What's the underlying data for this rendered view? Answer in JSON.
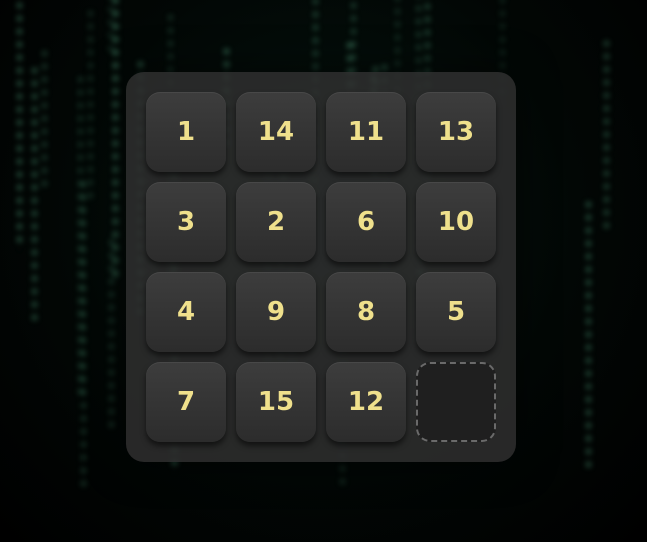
{
  "puzzle": {
    "rows": [
      [
        "1",
        "14",
        "11",
        "13"
      ],
      [
        "3",
        "2",
        "6",
        "10"
      ],
      [
        "4",
        "9",
        "8",
        "5"
      ],
      [
        "7",
        "15",
        "12",
        ""
      ]
    ]
  },
  "colors": {
    "tile_text": "#efe08c",
    "tile_bg": "#333333",
    "board_bg": "#2e2e2e",
    "rain": "#6edcaa"
  }
}
